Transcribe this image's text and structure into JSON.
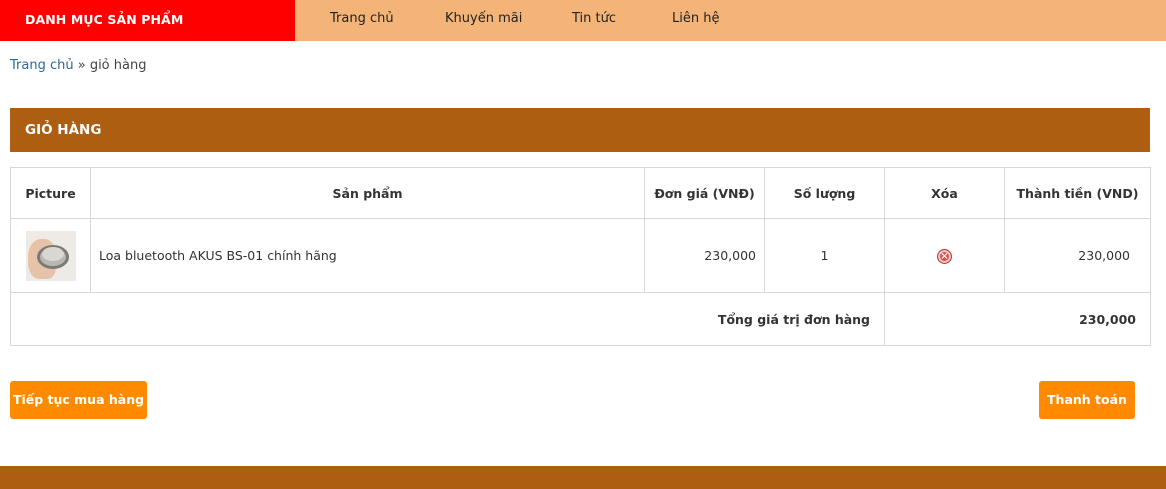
{
  "nav": {
    "category_label": "DANH MỤC SẢN PHẨM",
    "items": [
      "Trang chủ",
      "Khuyến mãi",
      "Tin tức",
      "Liên hệ"
    ]
  },
  "breadcrumb": {
    "home": "Trang chủ",
    "separator": " » ",
    "current": "giỏ hàng"
  },
  "cart": {
    "title": "GIỎ HÀNG",
    "columns": [
      "Picture",
      "Sản phẩm",
      "Đơn giá (VNĐ)",
      "Số lượng",
      "Xóa",
      "Thành tiền (VND)"
    ],
    "rows": [
      {
        "image_icon": "speaker-product-image",
        "product": "Loa bluetooth AKUS BS-01 chính hãng",
        "unit_price": "230,000",
        "quantity": "1",
        "delete_icon": "remove-icon",
        "subtotal": "230,000"
      }
    ],
    "total_label": "Tổng giá trị đơn hàng",
    "total_value": "230,000"
  },
  "actions": {
    "continue_label": "Tiếp tục mua hàng",
    "checkout_label": "Thanh toán"
  },
  "colors": {
    "nav_bg": "#f4b477",
    "category_bg": "#ff0000",
    "header_bg": "#ae5e11",
    "button_bg": "#ff8a00",
    "total_color": "#e00000"
  }
}
